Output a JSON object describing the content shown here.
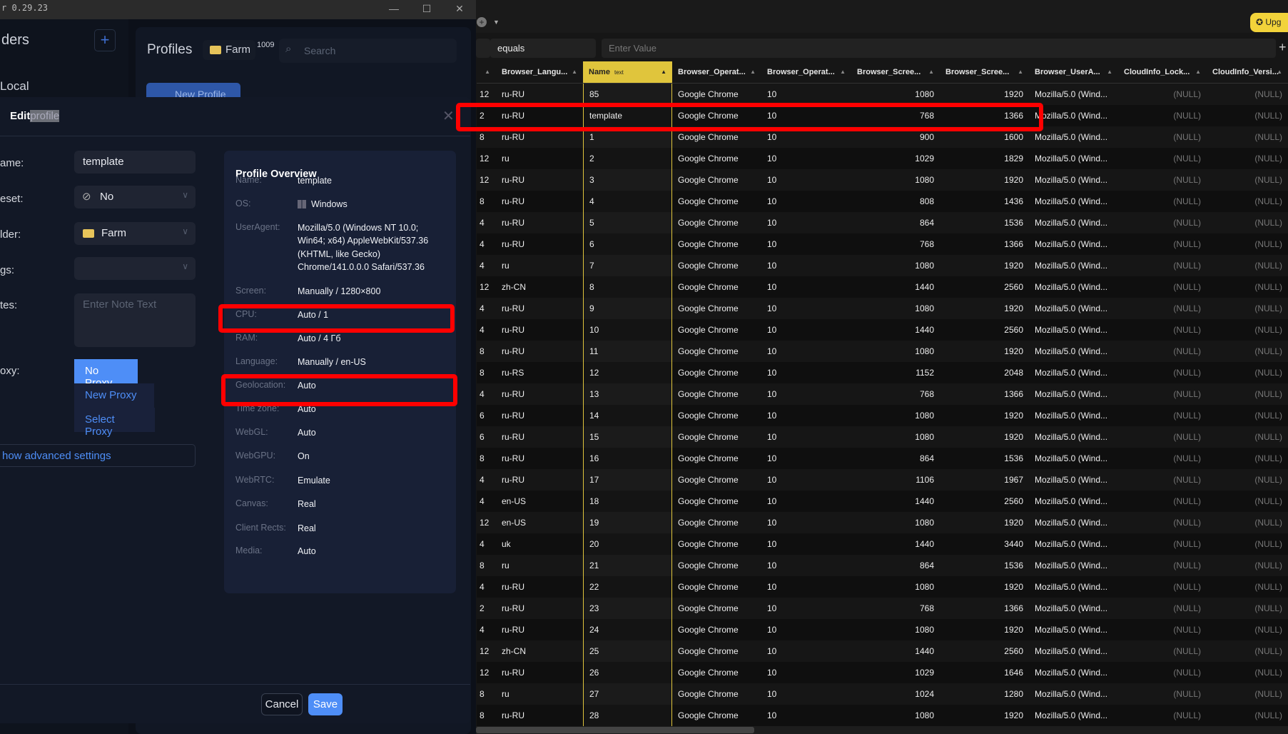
{
  "window": {
    "title": "r 0.29.23",
    "minimize": "—",
    "maximize": "☐",
    "close": "✕"
  },
  "app": {
    "sidebar_title": "ders",
    "sidebar_add": "+",
    "sidebar_local": "Local",
    "profiles_title": "Profiles",
    "folder_chip": "Farm",
    "folder_count": "1009",
    "search_placeholder": "Search",
    "new_profile": "New Profile"
  },
  "dialog": {
    "title_edit": "Edit",
    "title_profile": "profile",
    "close": "✕",
    "labels": {
      "name": "ame:",
      "preset": "eset:",
      "folder": "lder:",
      "tags": "gs:",
      "notes": "tes:",
      "proxy": "oxy:"
    },
    "name_value": "template",
    "preset_value": "No",
    "folder_value": "Farm",
    "tags_value": "",
    "notes_placeholder": "Enter Note Text",
    "proxy_options": [
      "No Proxy",
      "New Proxy",
      "Select Proxy"
    ],
    "advanced": "how advanced settings",
    "cancel": "Cancel",
    "save": "Save",
    "overview": {
      "title": "Profile Overview",
      "rows": [
        {
          "label": "Name:",
          "value": "template"
        },
        {
          "label": "OS:",
          "value": "Windows"
        },
        {
          "label": "UserAgent:",
          "value": "Mozilla/5.0 (Windows NT 10.0; Win64; x64) AppleWebKit/537.36 (KHTML, like Gecko) Chrome/141.0.0.0 Safari/537.36"
        },
        {
          "label": "Screen:",
          "value": "Manually / 1280×800"
        },
        {
          "label": "CPU:",
          "value": "Auto / 1"
        },
        {
          "label": "RAM:",
          "value": "Auto / 4 Гб"
        },
        {
          "label": "Language:",
          "value": "Manually / en-US"
        },
        {
          "label": "Geolocation:",
          "value": "Auto"
        },
        {
          "label": "Time zone:",
          "value": "Auto"
        },
        {
          "label": "WebGL:",
          "value": "Auto"
        },
        {
          "label": "WebGPU:",
          "value": "On"
        },
        {
          "label": "WebRTC:",
          "value": "Emulate"
        },
        {
          "label": "Canvas:",
          "value": "Real"
        },
        {
          "label": "Client Rects:",
          "value": "Real"
        },
        {
          "label": "Media:",
          "value": "Auto"
        }
      ]
    }
  },
  "db": {
    "upgrade": "Upg",
    "filter_op": "equals",
    "filter_value_placeholder": "Enter Value",
    "add_filter": "+",
    "columns": [
      "",
      "Browser_Langu...",
      "Name",
      "Browser_Operat...",
      "Browser_Operat...",
      "Browser_Scree...",
      "Browser_Scree...",
      "Browser_UserA...",
      "CloudInfo_Lock...",
      "CloudInfo_Versi..."
    ],
    "name_col_type": "text",
    "os_value": "Google Chrome",
    "os_version": "10",
    "ua_value": "Mozilla/5.0 (Wind...",
    "null_value": "(NULL)",
    "rows": [
      [
        "12",
        "ru-RU",
        "85",
        "1080",
        "1920"
      ],
      [
        "2",
        "ru-RU",
        "template",
        "768",
        "1366"
      ],
      [
        "8",
        "ru-RU",
        "1",
        "900",
        "1600"
      ],
      [
        "12",
        "ru",
        "2",
        "1029",
        "1829"
      ],
      [
        "12",
        "ru-RU",
        "3",
        "1080",
        "1920"
      ],
      [
        "8",
        "ru-RU",
        "4",
        "808",
        "1436"
      ],
      [
        "4",
        "ru-RU",
        "5",
        "864",
        "1536"
      ],
      [
        "4",
        "ru-RU",
        "6",
        "768",
        "1366"
      ],
      [
        "4",
        "ru",
        "7",
        "1080",
        "1920"
      ],
      [
        "12",
        "zh-CN",
        "8",
        "1440",
        "2560"
      ],
      [
        "4",
        "ru-RU",
        "9",
        "1080",
        "1920"
      ],
      [
        "4",
        "ru-RU",
        "10",
        "1440",
        "2560"
      ],
      [
        "8",
        "ru-RU",
        "11",
        "1080",
        "1920"
      ],
      [
        "8",
        "ru-RS",
        "12",
        "1152",
        "2048"
      ],
      [
        "4",
        "ru-RU",
        "13",
        "768",
        "1366"
      ],
      [
        "6",
        "ru-RU",
        "14",
        "1080",
        "1920"
      ],
      [
        "6",
        "ru-RU",
        "15",
        "1080",
        "1920"
      ],
      [
        "8",
        "ru-RU",
        "16",
        "864",
        "1536"
      ],
      [
        "4",
        "ru-RU",
        "17",
        "1106",
        "1967"
      ],
      [
        "4",
        "en-US",
        "18",
        "1440",
        "2560"
      ],
      [
        "12",
        "en-US",
        "19",
        "1080",
        "1920"
      ],
      [
        "4",
        "uk",
        "20",
        "1440",
        "3440"
      ],
      [
        "8",
        "ru",
        "21",
        "864",
        "1536"
      ],
      [
        "4",
        "ru-RU",
        "22",
        "1080",
        "1920"
      ],
      [
        "2",
        "ru-RU",
        "23",
        "768",
        "1366"
      ],
      [
        "4",
        "ru-RU",
        "24",
        "1080",
        "1920"
      ],
      [
        "12",
        "zh-CN",
        "25",
        "1440",
        "2560"
      ],
      [
        "12",
        "ru-RU",
        "26",
        "1029",
        "1646"
      ],
      [
        "8",
        "ru",
        "27",
        "1024",
        "1280"
      ],
      [
        "8",
        "ru-RU",
        "28",
        "1080",
        "1920"
      ]
    ]
  },
  "colors": {
    "highlight": "#ff0000",
    "name_col": "#e0c53c",
    "accent": "#4e8ef7"
  }
}
